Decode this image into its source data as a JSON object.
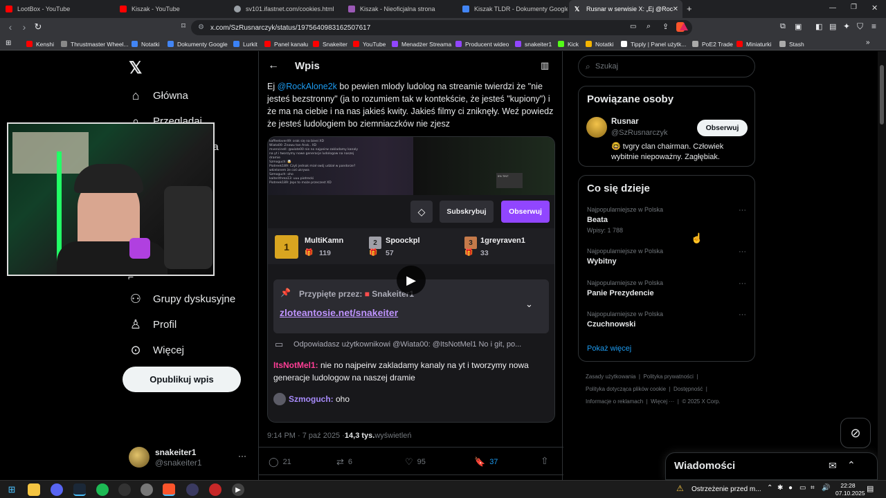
{
  "tabs": [
    {
      "label": "LootBox - YouTube",
      "color": "#ff0000"
    },
    {
      "label": "Kiszak - YouTube",
      "color": "#ff0000"
    },
    {
      "label": "sv101.ifastnet.com/cookies.html",
      "color": "#9aa0a6"
    },
    {
      "label": "Kiszak - Nieoficjalna strona",
      "color": "#9b59b6"
    },
    {
      "label": "Kiszak TLDR - Dokumenty Google",
      "color": "#4285f4"
    },
    {
      "label": "Rusnar w serwisie X: „Ej @RockAl",
      "color": "#ffffff"
    }
  ],
  "url": "x.com/SzRusnarczyk/status/1975640983162507617",
  "bookmarks": [
    {
      "label": "Kenshi",
      "color": "#ff0000"
    },
    {
      "label": "Thrustmaster Wheel...",
      "color": "#888888"
    },
    {
      "label": "Notatki",
      "color": "#4285f4"
    },
    {
      "label": "Dokumenty Google",
      "color": "#4285f4"
    },
    {
      "label": "Lurkit",
      "color": "#3b82f6"
    },
    {
      "label": "Panel kanału",
      "color": "#ff0000"
    },
    {
      "label": "Snakeiter",
      "color": "#ff0000"
    },
    {
      "label": "YouTube",
      "color": "#ff0000"
    },
    {
      "label": "Menadżer Streama",
      "color": "#9146ff"
    },
    {
      "label": "Producent wideo",
      "color": "#9146ff"
    },
    {
      "label": "snakeiter1",
      "color": "#9146ff"
    },
    {
      "label": "Kick",
      "color": "#53fc18"
    },
    {
      "label": "Notatki",
      "color": "#f4b400"
    },
    {
      "label": "Tipply | Panel użytk...",
      "color": "#222222"
    },
    {
      "label": "PoE2 Trade",
      "color": "#aaaaaa"
    },
    {
      "label": "Miniaturki",
      "color": "#ff0000"
    },
    {
      "label": "Stash",
      "color": "#aaaaaa"
    }
  ],
  "sidebar": {
    "items": [
      {
        "label": "Główna"
      },
      {
        "label": "Przeglądaj"
      },
      {
        "label": "Grupy dyskusyjne"
      },
      {
        "label": "Profil"
      },
      {
        "label": "Więcej"
      }
    ],
    "partial_label": "ia",
    "post_button": "Opublikuj wpis",
    "account_name": "snakeiter1",
    "account_handle": "@snakeiter1"
  },
  "header": {
    "title": "Wpis"
  },
  "tweet": {
    "mention": "@RockAlone2k",
    "prefix": "Ej ",
    "text": " bo pewien mlody ludolog na streamie twierdzi że \"nie jesteś bezstronny\" (ja to rozumiem tak w kontekście, że jesteś \"kupiony\") i że ma na ciebie i na nas jakieś kwity. Jakieś filmy ci zniknęły. Weź powiedz że jesteś ludologiem bo ziemniaczków nie zjesz",
    "time": "9:14 PM · 7 paź 2025 · ",
    "views_count": "14,3 tys.",
    "views_label": " wyświetleń",
    "replies": "21",
    "reposts": "6",
    "likes": "95",
    "bookmarks": "37"
  },
  "media": {
    "subscribe": "Subskrybuj",
    "follow": "Obserwuj",
    "gifters": [
      {
        "rank": "1",
        "name": "MultiKamn",
        "count": "119"
      },
      {
        "rank": "2",
        "name": "Spoockpl",
        "count": "57"
      },
      {
        "rank": "3",
        "name": "1greyraven1",
        "count": "33"
      }
    ],
    "pinned_by": "Przypięte przez:",
    "pinned_user": "Snakeiter1",
    "pinned_link": "zloteantosie.net/snakeiter",
    "reply_to": "Odpowiadasz użytkownikowi @Wiata00: @ItsNotMel1 No i git, po...",
    "chat": [
      {
        "user": "ItsNotMel1:",
        "msg": " nie no najpeirw zakladamy kanaly na yt i tworzymy nowa generacje ludologow na naszej dramie",
        "color": "#ff3e96"
      },
      {
        "user": "Szmoguch:",
        "msg": " oho",
        "color": "#a78bfa"
      }
    ],
    "stream_chat_lines": [
      "kaffeelover49: orak się na bieei XD",
      "Wiata00: Znowu tan Arak.. XD",
      "mvencinell: @wiate00 nie no najpeirw zakladamy kanaly",
      "na yt i tworzymy nowe generacje ludologow na naszej",
      "dramie",
      "Szmoguch: 🤯",
      "Piotreek189: Czyli jednak miał swój udział w pandorze?",
      "wkielonem że coś ukrywa",
      "Szmoguch: oho",
      "kaiterithrea13: uuu piotrecki",
      "Piotreek189: Jeps to może przeczest XD"
    ]
  },
  "search": {
    "placeholder": "Szukaj"
  },
  "related": {
    "title": "Powiązane osoby",
    "name": "Rusnar",
    "handle": "@SzRusnarczyk",
    "follow": "Obserwuj",
    "bio": "🤓 tvgry clan chairman. Człowiek wybitnie niepoważny. Zagłębiak."
  },
  "trends": {
    "title": "Co się dzieje",
    "items": [
      {
        "meta": "Najpopularniejsze w Polska",
        "name": "Beata",
        "count": "Wpisy: 1 788"
      },
      {
        "meta": "Najpopularniejsze w Polska",
        "name": "Wybitny",
        "count": ""
      },
      {
        "meta": "Najpopularniejsze w Polska",
        "name": "Panie Prezydencie",
        "count": ""
      },
      {
        "meta": "Najpopularniejsze w Polska",
        "name": "Czuchnowski",
        "count": ""
      }
    ],
    "show_more": "Pokaż więcej"
  },
  "footer": {
    "line1": [
      "Zasady użytkowania",
      "Polityka prywatności"
    ],
    "line2": [
      "Polityka dotycząca plików cookie",
      "Dostępność"
    ],
    "line3": [
      "Informacje o reklamach",
      "Więcej ···",
      "© 2025 X Corp."
    ]
  },
  "messages": {
    "title": "Wiadomości"
  },
  "taskbar": {
    "notification": "Ostrzeżenie przed m...",
    "time": "22:28",
    "date": "07.10.2025"
  },
  "colors": {
    "accent": "#1d9bf0",
    "twitch": "#9146ff",
    "bookmark_active": "#1d9bf0"
  }
}
